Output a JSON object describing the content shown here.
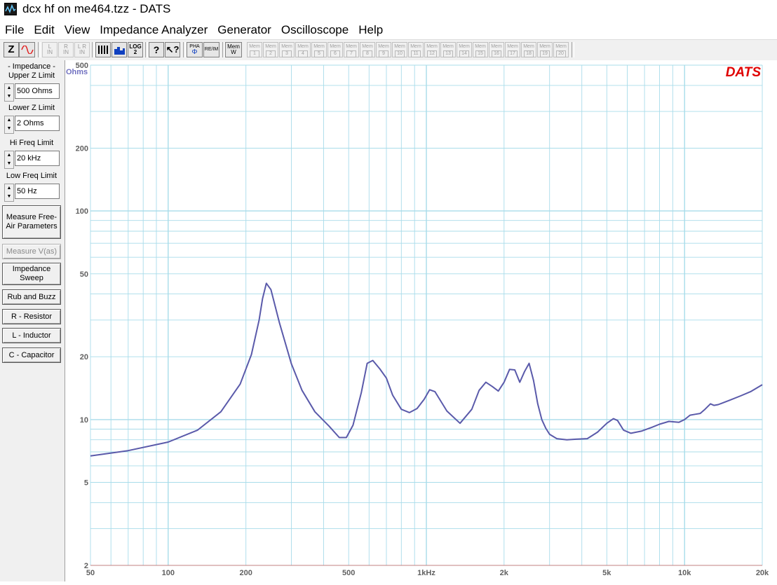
{
  "window": {
    "title": "dcx hf on me464.tzz - DATS"
  },
  "menu": [
    "File",
    "Edit",
    "View",
    "Impedance Analyzer",
    "Generator",
    "Oscilloscope",
    "Help"
  ],
  "toolbar": {
    "z_label": "Z",
    "l_in": [
      "L",
      "IN"
    ],
    "r_in": [
      "R",
      "IN"
    ],
    "lr_in": [
      "L R",
      "IN"
    ],
    "log_label": "LOG",
    "pha_label": "PHA",
    "re_im_label": "RE/IM",
    "mem_w_label": "Mem W",
    "mem_prefix": "Mem",
    "mem_slots": [
      "1",
      "2",
      "3",
      "4",
      "5",
      "6",
      "7",
      "8",
      "9",
      "10",
      "11",
      "12",
      "13",
      "14",
      "15",
      "16",
      "17",
      "18",
      "19",
      "20"
    ]
  },
  "left_panel": {
    "impedance_header": "- Impedance -",
    "upper_z": {
      "label": "Upper Z Limit",
      "value": "500 Ohms"
    },
    "lower_z": {
      "label": "Lower Z Limit",
      "value": "2 Ohms"
    },
    "hi_freq": {
      "label": "Hi Freq Limit",
      "value": "20 kHz"
    },
    "low_freq": {
      "label": "Low Freq Limit",
      "value": "50 Hz"
    },
    "buttons": {
      "measure_free_air": "Measure Free-Air Parameters",
      "measure_vas": "Measure V(as)",
      "impedance_sweep": "Impedance Sweep",
      "rub_buzz": "Rub and Buzz",
      "resistor": "R - Resistor",
      "inductor": "L - Inductor",
      "capacitor": "C - Capacitor"
    }
  },
  "colors": {
    "grid": "#a8dcea",
    "curve": "#5a5aaa",
    "logo": "#e00000",
    "axis_label": "#7070c0",
    "baseline": "#c08080"
  },
  "chart_data": {
    "type": "line",
    "brand": "DATS",
    "ylabel": "Ohms",
    "x_scale": "log",
    "y_scale": "log",
    "xlim": [
      50,
      20000
    ],
    "ylim": [
      2,
      500
    ],
    "x_tick_labels": [
      {
        "v": 50,
        "t": "50"
      },
      {
        "v": 100,
        "t": "100"
      },
      {
        "v": 200,
        "t": "200"
      },
      {
        "v": 500,
        "t": "500"
      },
      {
        "v": 1000,
        "t": "1kHz"
      },
      {
        "v": 2000,
        "t": "2k"
      },
      {
        "v": 5000,
        "t": "5k"
      },
      {
        "v": 10000,
        "t": "10k"
      },
      {
        "v": 20000,
        "t": "20k"
      }
    ],
    "y_tick_labels": [
      {
        "v": 2,
        "t": "2"
      },
      {
        "v": 5,
        "t": "5"
      },
      {
        "v": 10,
        "t": "10"
      },
      {
        "v": 20,
        "t": "20"
      },
      {
        "v": 50,
        "t": "50"
      },
      {
        "v": 100,
        "t": "100"
      },
      {
        "v": 200,
        "t": "200"
      },
      {
        "v": 500,
        "t": "500"
      }
    ],
    "series": [
      {
        "x": [
          50,
          70,
          100,
          130,
          160,
          190,
          210,
          225,
          232,
          240,
          250,
          270,
          300,
          330,
          370,
          420,
          460,
          490,
          520,
          560,
          590,
          620,
          660,
          700,
          740,
          800,
          860,
          920,
          980,
          1030,
          1080,
          1200,
          1350,
          1500,
          1600,
          1700,
          1800,
          1900,
          2000,
          2100,
          2200,
          2300,
          2400,
          2500,
          2600,
          2700,
          2800,
          2900,
          3000,
          3200,
          3500,
          3800,
          4200,
          4600,
          5000,
          5300,
          5500,
          5800,
          6200,
          6800,
          7500,
          8000,
          8700,
          9500,
          10000,
          10500,
          11000,
          11500,
          12000,
          12600,
          13000,
          13500,
          14000,
          15000,
          16500,
          18000,
          20000
        ],
        "y": [
          6.7,
          7.1,
          7.8,
          8.9,
          10.9,
          14.8,
          20.5,
          30,
          38,
          45,
          42,
          29,
          18.5,
          13.8,
          10.9,
          9.3,
          8.2,
          8.2,
          9.4,
          13.5,
          18.6,
          19.2,
          17.5,
          15.8,
          13.1,
          11.2,
          10.8,
          11.3,
          12.5,
          13.9,
          13.6,
          11.0,
          9.6,
          11.2,
          13.8,
          15.1,
          14.4,
          13.7,
          15.1,
          17.4,
          17.3,
          15.1,
          17.0,
          18.6,
          15.4,
          11.9,
          10.0,
          9.1,
          8.5,
          8.1,
          8.0,
          8.05,
          8.1,
          8.7,
          9.6,
          10.1,
          9.9,
          8.9,
          8.6,
          8.8,
          9.2,
          9.5,
          9.8,
          9.7,
          10.0,
          10.5,
          10.6,
          10.7,
          11.2,
          11.9,
          11.7,
          11.8,
          12.0,
          12.4,
          13.0,
          13.6,
          14.7
        ]
      }
    ],
    "grid": true
  }
}
